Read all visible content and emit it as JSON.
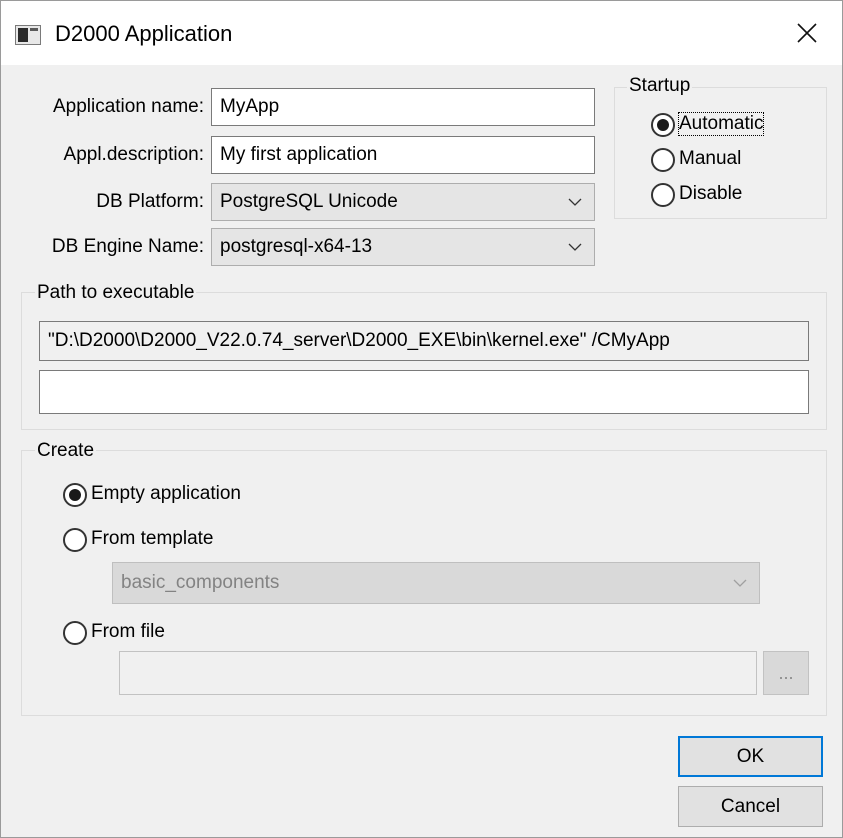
{
  "window": {
    "title": "D2000 Application"
  },
  "form": {
    "app_name_label": "Application name:",
    "app_name_value": "MyApp",
    "description_label": "Appl.description:",
    "description_value": "My first application",
    "db_platform_label": "DB Platform:",
    "db_platform_value": "PostgreSQL Unicode",
    "db_engine_label": "DB Engine Name:",
    "db_engine_value": "postgresql-x64-13"
  },
  "startup": {
    "title": "Startup",
    "options": [
      {
        "label": "Automatic",
        "checked": true
      },
      {
        "label": "Manual",
        "checked": false
      },
      {
        "label": "Disable",
        "checked": false
      }
    ]
  },
  "path": {
    "title": "Path to executable",
    "value": "\"D:\\D2000\\D2000_V22.0.74_server\\D2000_EXE\\bin\\kernel.exe\" /CMyApp",
    "extra_value": ""
  },
  "create": {
    "title": "Create",
    "empty_label": "Empty application",
    "template_label": "From template",
    "template_value": "basic_components",
    "file_label": "From file",
    "browse_label": "..."
  },
  "buttons": {
    "ok": "OK",
    "cancel": "Cancel"
  }
}
